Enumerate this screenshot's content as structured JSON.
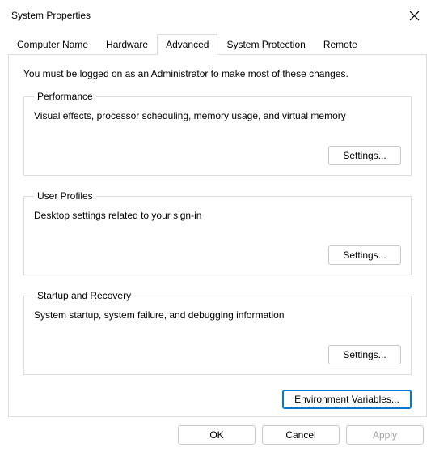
{
  "window": {
    "title": "System Properties"
  },
  "tabs": {
    "computer_name": "Computer Name",
    "hardware": "Hardware",
    "advanced": "Advanced",
    "system_protection": "System Protection",
    "remote": "Remote"
  },
  "intro": "You must be logged on as an Administrator to make most of these changes.",
  "performance": {
    "legend": "Performance",
    "desc": "Visual effects, processor scheduling, memory usage, and virtual memory",
    "button": "Settings..."
  },
  "user_profiles": {
    "legend": "User Profiles",
    "desc": "Desktop settings related to your sign-in",
    "button": "Settings..."
  },
  "startup_recovery": {
    "legend": "Startup and Recovery",
    "desc": "System startup, system failure, and debugging information",
    "button": "Settings..."
  },
  "env_button": "Environment Variables...",
  "buttons": {
    "ok": "OK",
    "cancel": "Cancel",
    "apply": "Apply"
  }
}
